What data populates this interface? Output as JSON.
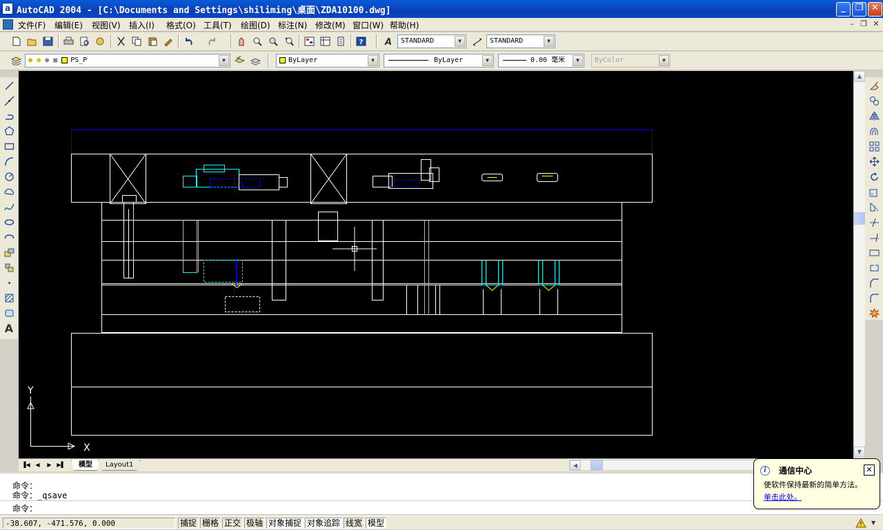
{
  "window": {
    "app_icon_letter": "a",
    "title": "AutoCAD 2004 - [C:\\Documents and Settings\\shiliming\\桌面\\ZDA10100.dwg]",
    "minimize": "_",
    "maximize": "❐",
    "close": "✕"
  },
  "menubar": {
    "items": [
      "文件(F)",
      "编辑(E)",
      "视图(V)",
      "插入(I)",
      "格式(O)",
      "工具(T)",
      "绘图(D)",
      "标注(N)",
      "修改(M)",
      "窗口(W)",
      "帮助(H)"
    ],
    "mdi_minimize": "–",
    "mdi_restore": "❐",
    "mdi_close": "✕"
  },
  "toolbar_standard": {
    "text_style": "STANDARD",
    "dim_style": "STANDARD"
  },
  "toolbar_properties": {
    "layer": "PS_P",
    "color": "ByLayer",
    "linetype": "ByLayer",
    "lineweight": "0.00 毫米",
    "plotstyle": "ByColor"
  },
  "ucs": {
    "y_label": "Y",
    "x_label": "X"
  },
  "tabs": {
    "model": "模型",
    "layout1": "Layout1"
  },
  "command": {
    "lines": [
      "命令：",
      "命令：_qsave",
      "命令："
    ]
  },
  "statusbar": {
    "coords": "-38.607,  -471.576,  0.000",
    "buttons": [
      {
        "label": "捕捉",
        "on": false
      },
      {
        "label": "栅格",
        "on": false
      },
      {
        "label": "正交",
        "on": false
      },
      {
        "label": "极轴",
        "on": false
      },
      {
        "label": "对象捕捉",
        "on": true
      },
      {
        "label": "对象追踪",
        "on": true
      },
      {
        "label": "线宽",
        "on": false
      },
      {
        "label": "模型",
        "on": true
      }
    ]
  },
  "balloon": {
    "icon": "i",
    "title": "通信中心",
    "body": "使软件保持最新的简单方法。",
    "link": "单击此处。",
    "close": "✕"
  },
  "colors": {
    "canvas_bg": "#000000",
    "cad_white": "#ffffff",
    "cad_cyan": "#00ffff",
    "cad_blue": "#0000ff",
    "cad_yellow": "#ffff00"
  }
}
